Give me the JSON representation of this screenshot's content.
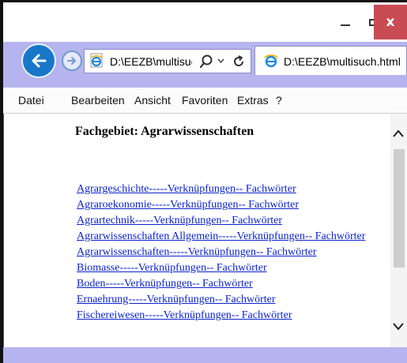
{
  "window": {
    "accent": "#b6b4ee",
    "close_color": "#c94b53",
    "close_label": "x"
  },
  "nav": {
    "address_text": "D:\\EEZB\\multisuch",
    "tab_title": "D:\\EEZB\\multisuch.html",
    "back_icon": "back-arrow-icon",
    "forward_icon": "forward-arrow-icon",
    "search_icon": "search-icon",
    "refresh_icon": "refresh-icon"
  },
  "menu": [
    "Datei",
    "Bearbeiten",
    "Ansicht",
    "Favoriten",
    "Extras",
    "?"
  ],
  "content": {
    "heading": "Fachgebiet: Agrarwissenschaften",
    "links": [
      "Agrargeschichte-----Verknüpfungen-- Fachwörter",
      "Agraroekonomie-----Verknüpfungen-- Fachwörter",
      "Agrartechnik-----Verknüpfungen-- Fachwörter",
      "Agrarwissenschaften Allgemein-----Verknüpfungen-- Fachwörter",
      "Agrarwissenschaften-----Verknüpfungen-- Fachwörter",
      "Biomasse-----Verknüpfungen-- Fachwörter",
      "Boden-----Verknüpfungen-- Fachwörter",
      "Ernaehrung-----Verknüpfungen-- Fachwörter",
      "Fischereiwesen-----Verknüpfungen-- Fachwörter"
    ]
  }
}
